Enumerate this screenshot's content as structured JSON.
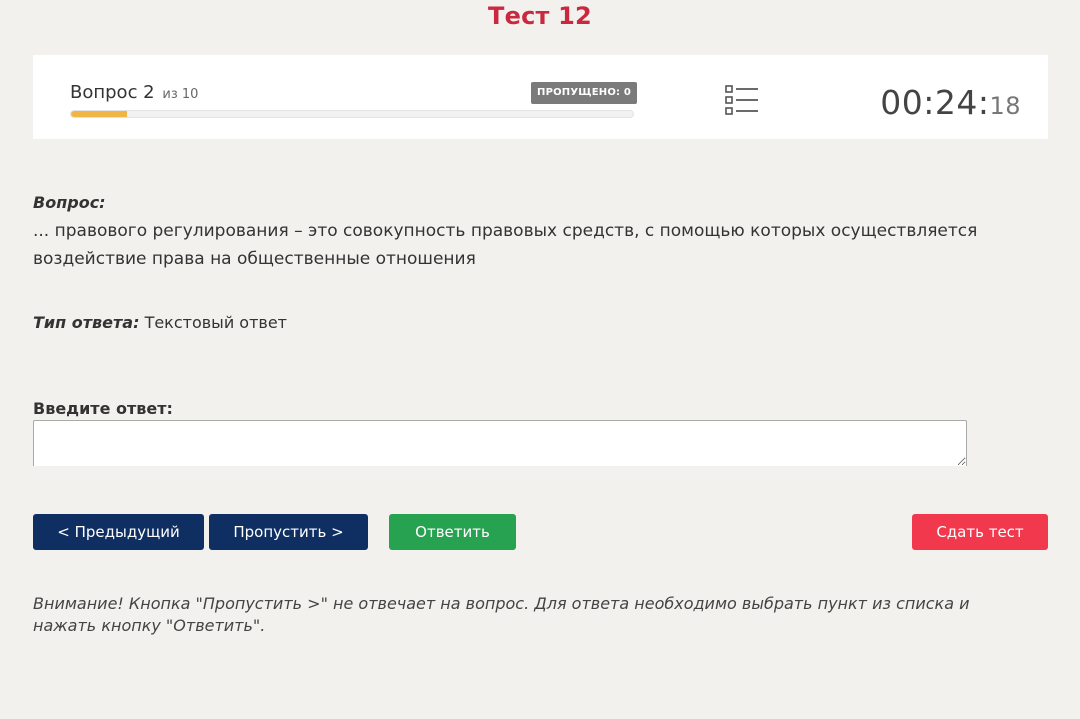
{
  "page": {
    "title": "Тест 12"
  },
  "status": {
    "question_label": "Вопрос 2",
    "of_total": "из 10",
    "progress_fraction": 0.1,
    "skipped_badge": "ПРОПУЩЕНО: 0",
    "list_icon": "question-list-icon",
    "timer_main": "00:24:",
    "timer_seconds": "18"
  },
  "question": {
    "label": "Вопрос:",
    "text": "... правового регулирования – это совокупность правовых средств, с помощью которых осуществляется воздействие права на общественные отношения"
  },
  "answer_type": {
    "label": "Тип ответа:",
    "value": "Текстовый ответ"
  },
  "answer_input": {
    "label": "Введите ответ:",
    "value": "",
    "placeholder": ""
  },
  "buttons": {
    "prev": "< Предыдущий",
    "skip": "Пропустить >",
    "answer": "Ответить",
    "finish": "Сдать тест"
  },
  "warning": "Внимание! Кнопка \"Пропустить >\" не отвечает на вопрос. Для ответа необходимо выбрать пункт из списка и нажать кнопку \"Ответить\".",
  "colors": {
    "title": "#c9283e",
    "progress": "#f0b545",
    "nav_button": "#0f2e62",
    "answer_button": "#27a251",
    "finish_button": "#f2384d",
    "badge": "#7a7a7a"
  }
}
